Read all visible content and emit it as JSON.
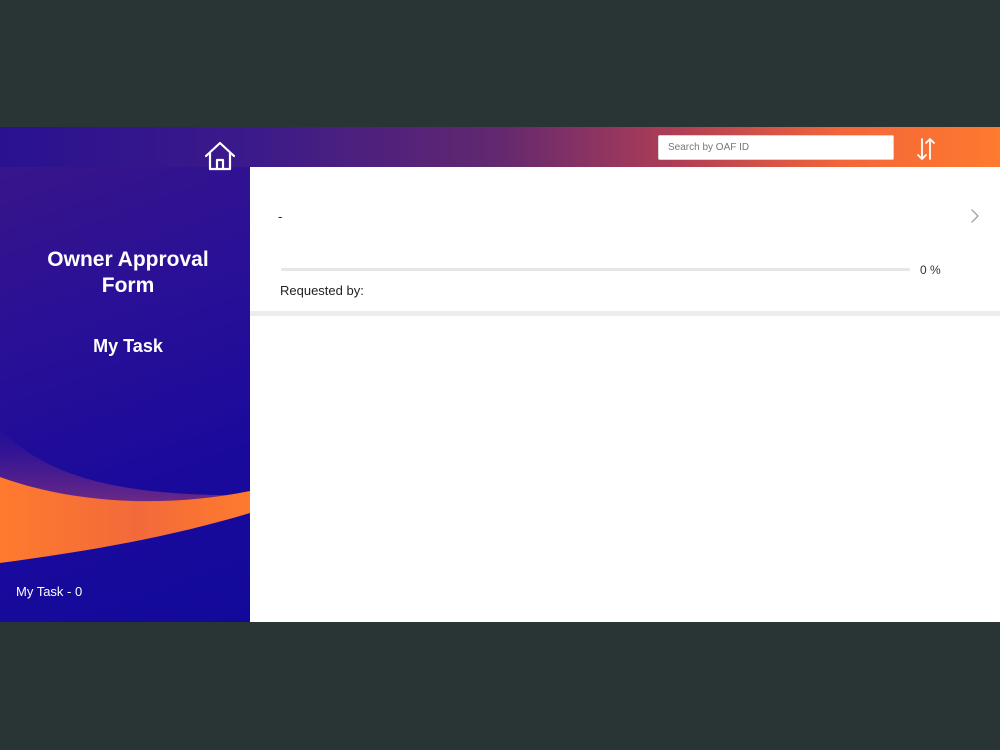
{
  "header": {
    "search_placeholder": "Search by OAF ID",
    "home_icon": "home-icon",
    "sort_icon": "sort-arrows-icon"
  },
  "sidebar": {
    "title": "Owner Approval\nForm",
    "subtitle": "My Task",
    "task_count": "My Task - 0"
  },
  "tasks": [
    {
      "title": "-",
      "progress_label": "0 %",
      "progress": 0,
      "requested_by_label": "Requested by:"
    }
  ],
  "colors": {
    "primary": "#2a1096",
    "accent": "#ff7a2e",
    "backdrop": "#293435"
  }
}
